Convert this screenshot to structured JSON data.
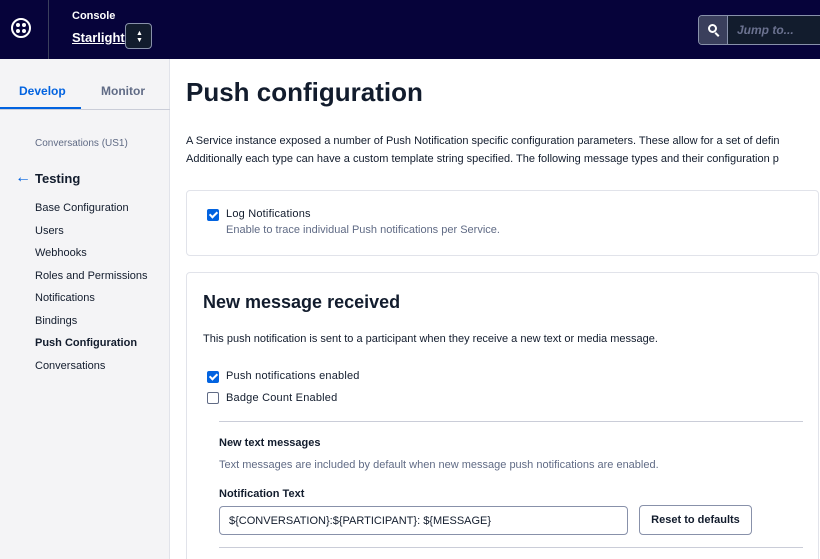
{
  "topbar": {
    "logo_icon": "twilio-logo-icon",
    "console_label": "Console",
    "account_name": "Starlight",
    "switcher_icon": "up-down-chevron-icon",
    "search_icon": "search-icon",
    "search_placeholder": "Jump to..."
  },
  "sidebar": {
    "tabs": [
      {
        "label": "Develop",
        "active": true
      },
      {
        "label": "Monitor",
        "active": false
      }
    ],
    "service_label": "Conversations (US1)",
    "back_icon": "arrow-left-icon",
    "section_title": "Testing",
    "items": [
      {
        "label": "Base Configuration",
        "active": false
      },
      {
        "label": "Users",
        "active": false
      },
      {
        "label": "Webhooks",
        "active": false
      },
      {
        "label": "Roles and Permissions",
        "active": false
      },
      {
        "label": "Notifications",
        "active": false
      },
      {
        "label": "Bindings",
        "active": false
      },
      {
        "label": "Push Configuration",
        "active": true
      },
      {
        "label": "Conversations",
        "active": false
      }
    ]
  },
  "main": {
    "title": "Push configuration",
    "intro_line1": "A Service instance exposed a number of Push Notification specific configuration parameters. These allow for a set of defin",
    "intro_line2": "Additionally each type can have a custom template string specified. The following message types and their configuration p",
    "log_card": {
      "checkbox_label": "Log Notifications",
      "checked": true,
      "help": "Enable to trace individual Push notifications per Service."
    },
    "new_message_card": {
      "title": "New message received",
      "description": "This push notification is sent to a participant when they receive a new text or media message.",
      "push_enabled": {
        "label": "Push notifications enabled",
        "checked": true
      },
      "badge_count": {
        "label": "Badge Count Enabled",
        "checked": false
      },
      "subsection_title": "New text messages",
      "subsection_help": "Text messages are included by default when new message push notifications are enabled.",
      "notification_text_label": "Notification Text",
      "notification_text_value": "${CONVERSATION}:${PARTICIPANT}: ${MESSAGE}",
      "reset_label": "Reset to defaults"
    }
  },
  "colors": {
    "topbar_bg": "#06033a",
    "accent": "#0263e0",
    "sidebar_bg": "#f4f4f6",
    "text": "#121c2d",
    "muted_text": "#606b85"
  }
}
